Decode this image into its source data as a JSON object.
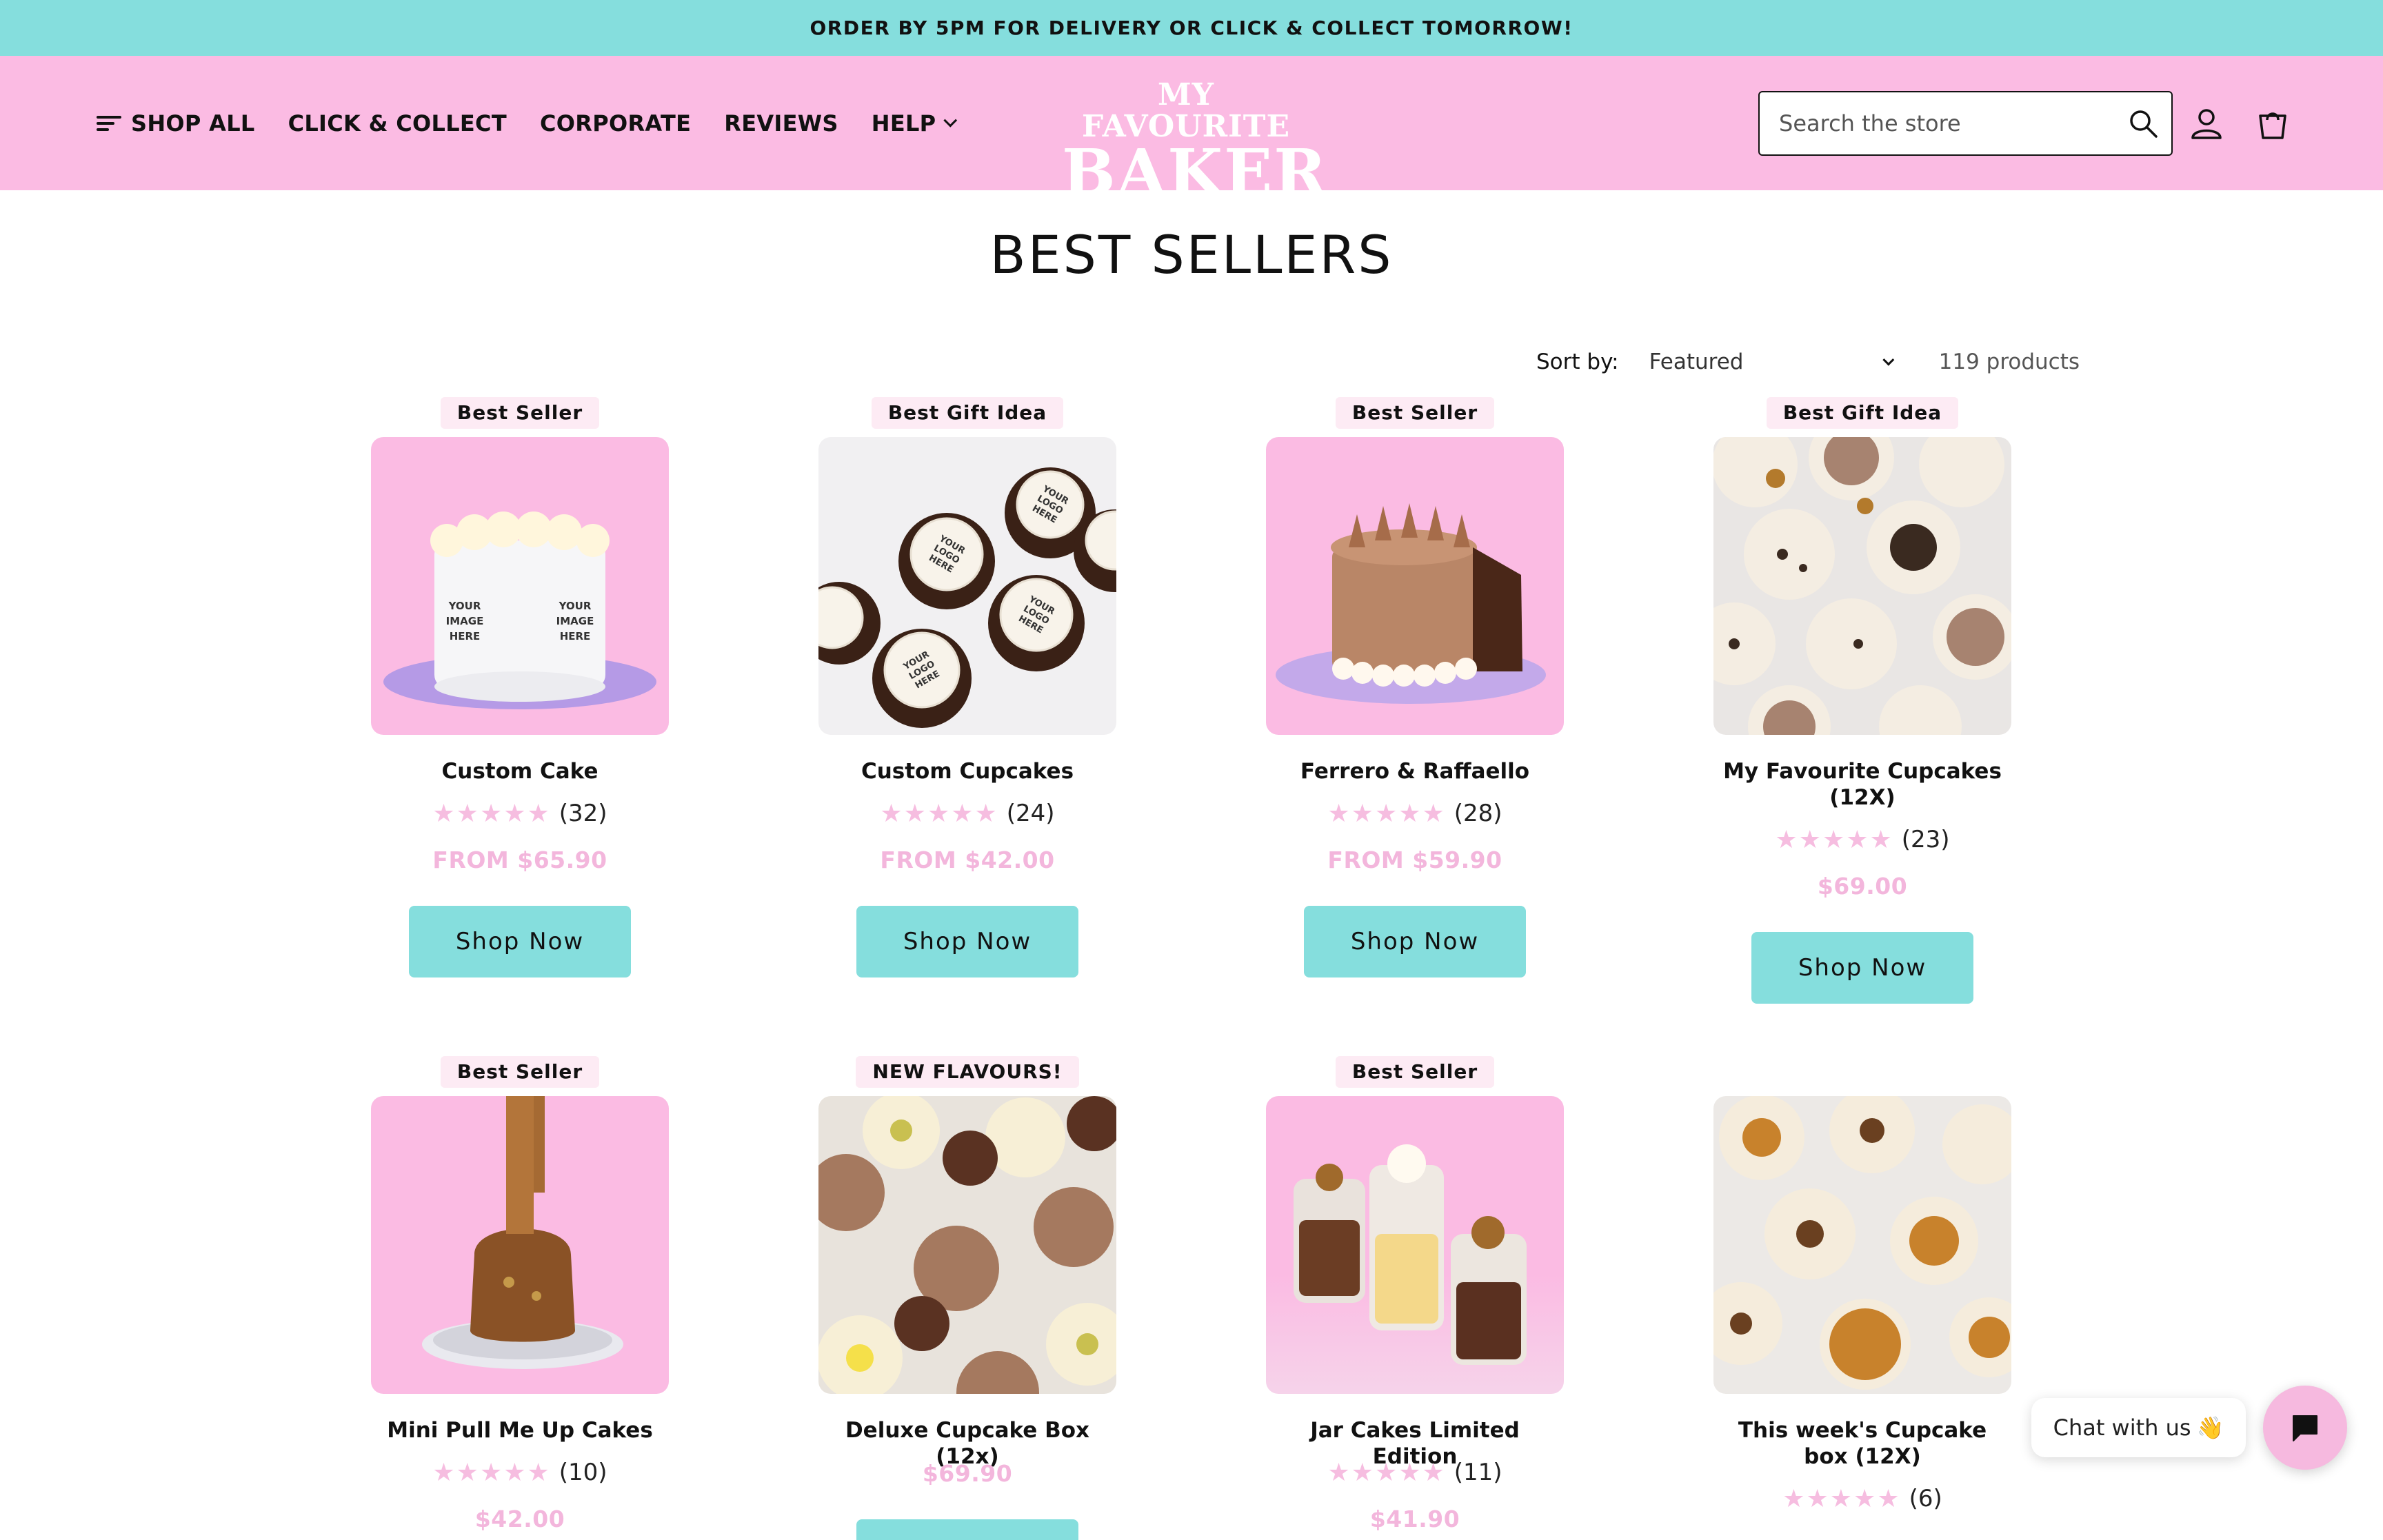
{
  "announcement": "ORDER BY 5PM FOR DELIVERY OR CLICK & COLLECT TOMORROW!",
  "nav": {
    "shop_all": "SHOP ALL",
    "click_collect": "CLICK & COLLECT",
    "corporate": "CORPORATE",
    "reviews": "REVIEWS",
    "help": "HELP"
  },
  "logo": {
    "line1": "MY FAVOURITE",
    "line2": "BAKER"
  },
  "search": {
    "placeholder": "Search the store"
  },
  "icons": {
    "menu": "menu-icon",
    "search": "search-icon",
    "account": "account-icon",
    "cart": "cart-icon",
    "chat": "chat-icon",
    "wave": "waving-hand-emoji"
  },
  "page": {
    "title": "BEST SELLERS"
  },
  "sort": {
    "label": "Sort by:",
    "selected": "Featured",
    "count": "119 products"
  },
  "colors": {
    "teal": "#85dedd",
    "pink": "#fbbbe3",
    "price_pink": "#f3b6dc"
  },
  "products": [
    {
      "badge": "Best Seller",
      "name": "Custom Cake",
      "stars": "★★★★★",
      "reviews": "(32)",
      "price": "FROM $65.90",
      "button": "Shop Now"
    },
    {
      "badge": "Best Gift Idea",
      "name": "Custom Cupcakes",
      "stars": "★★★★★",
      "reviews": "(24)",
      "price": "FROM $42.00",
      "button": "Shop Now"
    },
    {
      "badge": "Best Seller",
      "name": "Ferrero & Raffaello",
      "stars": "★★★★★",
      "reviews": "(28)",
      "price": "FROM $59.90",
      "button": "Shop Now"
    },
    {
      "badge": "Best Gift Idea",
      "name": "My Favourite Cupcakes (12X)",
      "stars": "★★★★★",
      "reviews": "(23)",
      "price": "$69.00",
      "button": "Shop Now"
    },
    {
      "badge": "Best Seller",
      "name": "Mini Pull Me Up Cakes",
      "stars": "★★★★★",
      "reviews": "(10)",
      "price": "$42.00"
    },
    {
      "badge": "NEW FLAVOURS!",
      "name": "Deluxe Cupcake Box (12x)",
      "price": "$69.90"
    },
    {
      "badge": "Best Seller",
      "name": "Jar Cakes Limited Edition",
      "stars": "★★★★★",
      "reviews": "(11)",
      "price": "$41.90"
    },
    {
      "name": "This week's Cupcake box (12X)",
      "stars": "★★★★★",
      "reviews": "(6)"
    }
  ],
  "image_text": {
    "custom_image": "YOUR IMAGE HERE",
    "custom_logo": "YOUR LOGO HERE"
  },
  "chat": {
    "label": "Chat with us",
    "emoji": "👋"
  }
}
